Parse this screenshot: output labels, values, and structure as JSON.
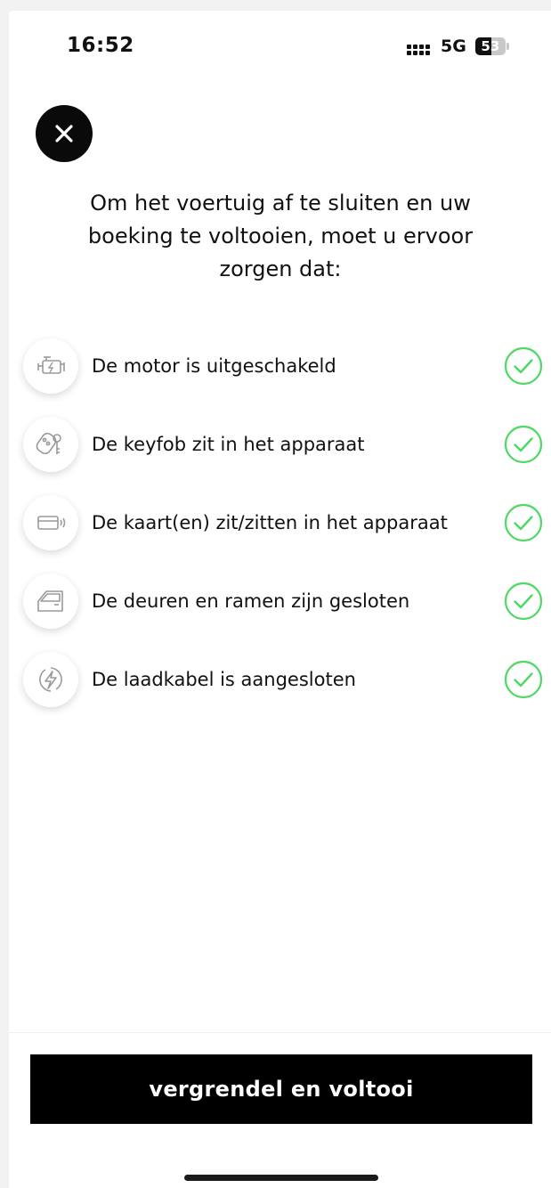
{
  "status_bar": {
    "time": "16:52",
    "network": "5G",
    "battery_level": "53",
    "battery_fraction": 0.53
  },
  "close_button": {
    "icon": "close-icon"
  },
  "heading": "Om het voertuig af te sluiten en uw boeking te voltooien, moet u ervoor zorgen dat:",
  "checklist": [
    {
      "icon": "engine-icon",
      "label": "De motor is uitgeschakeld",
      "checked": true
    },
    {
      "icon": "keyfob-icon",
      "label": "De keyfob zit in het apparaat",
      "checked": true
    },
    {
      "icon": "card-icon",
      "label": "De kaart(en) zit/zitten in het apparaat",
      "checked": true
    },
    {
      "icon": "car-door-icon",
      "label": "De deuren en ramen zijn gesloten",
      "checked": true
    },
    {
      "icon": "charging-cable-icon",
      "label": "De laadkabel is aangesloten",
      "checked": true
    }
  ],
  "primary_button": {
    "label": "vergrendel en voltooi"
  },
  "colors": {
    "check_green": "#4cd964",
    "button_bg": "#000000",
    "icon_gray": "#9a9a9a"
  }
}
